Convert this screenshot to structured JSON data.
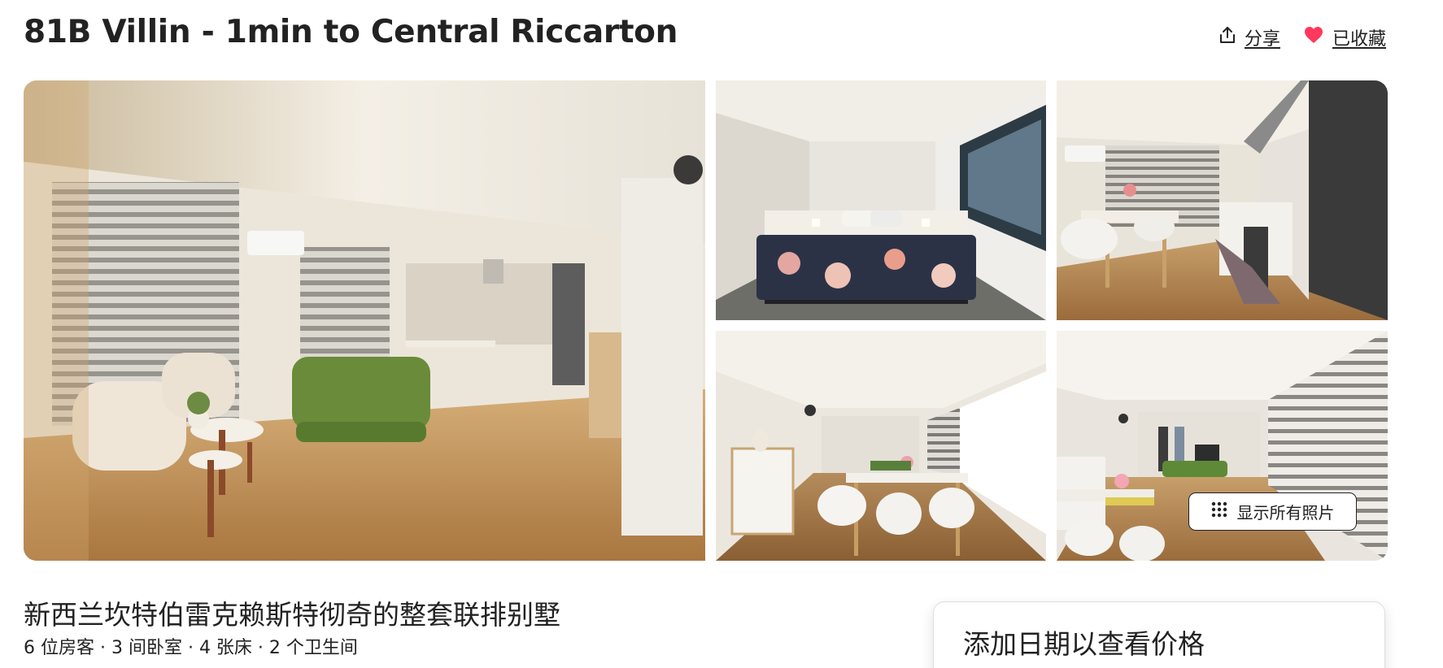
{
  "listing": {
    "title": "81B Villin - 1min to Central Riccarton",
    "subtitle": "新西兰坎特伯雷克赖斯特彻奇的整套联排别墅",
    "details": "6 位房客 · 3 间卧室 · 4 张床 · 2 个卫生间"
  },
  "actions": {
    "share_label": "分享",
    "saved_label": "已收藏",
    "share_icon": "share-icon",
    "saved_icon": "heart-icon"
  },
  "gallery": {
    "show_all_label": "显示所有照片",
    "show_all_icon": "grid-dots-icon",
    "photos": [
      "living-room",
      "bedroom",
      "kitchen-dining",
      "dining-room",
      "dining-living"
    ]
  },
  "booking": {
    "title": "添加日期以查看价格"
  },
  "colors": {
    "text": "#222222",
    "heart": "#FF385C",
    "border": "#DDDDDD"
  }
}
